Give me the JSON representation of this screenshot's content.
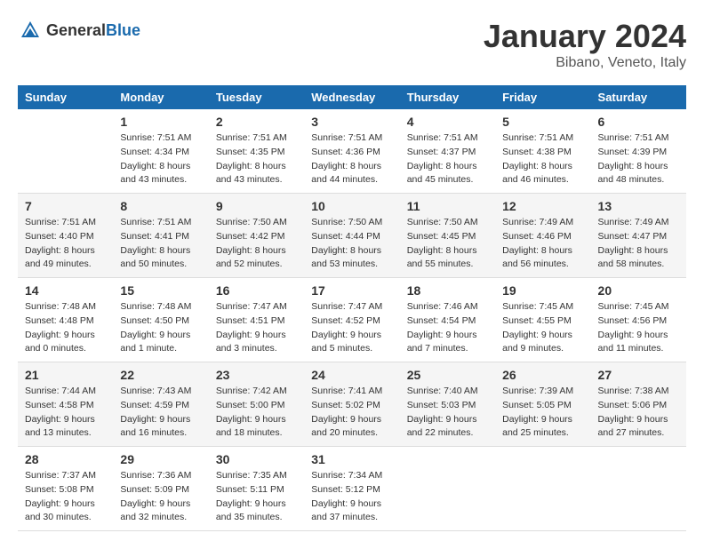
{
  "header": {
    "logo_general": "General",
    "logo_blue": "Blue",
    "title": "January 2024",
    "location": "Bibano, Veneto, Italy"
  },
  "days_of_week": [
    "Sunday",
    "Monday",
    "Tuesday",
    "Wednesday",
    "Thursday",
    "Friday",
    "Saturday"
  ],
  "weeks": [
    [
      {
        "day": "",
        "info": ""
      },
      {
        "day": "1",
        "info": "Sunrise: 7:51 AM\nSunset: 4:34 PM\nDaylight: 8 hours\nand 43 minutes."
      },
      {
        "day": "2",
        "info": "Sunrise: 7:51 AM\nSunset: 4:35 PM\nDaylight: 8 hours\nand 43 minutes."
      },
      {
        "day": "3",
        "info": "Sunrise: 7:51 AM\nSunset: 4:36 PM\nDaylight: 8 hours\nand 44 minutes."
      },
      {
        "day": "4",
        "info": "Sunrise: 7:51 AM\nSunset: 4:37 PM\nDaylight: 8 hours\nand 45 minutes."
      },
      {
        "day": "5",
        "info": "Sunrise: 7:51 AM\nSunset: 4:38 PM\nDaylight: 8 hours\nand 46 minutes."
      },
      {
        "day": "6",
        "info": "Sunrise: 7:51 AM\nSunset: 4:39 PM\nDaylight: 8 hours\nand 48 minutes."
      }
    ],
    [
      {
        "day": "7",
        "info": "Sunrise: 7:51 AM\nSunset: 4:40 PM\nDaylight: 8 hours\nand 49 minutes."
      },
      {
        "day": "8",
        "info": "Sunrise: 7:51 AM\nSunset: 4:41 PM\nDaylight: 8 hours\nand 50 minutes."
      },
      {
        "day": "9",
        "info": "Sunrise: 7:50 AM\nSunset: 4:42 PM\nDaylight: 8 hours\nand 52 minutes."
      },
      {
        "day": "10",
        "info": "Sunrise: 7:50 AM\nSunset: 4:44 PM\nDaylight: 8 hours\nand 53 minutes."
      },
      {
        "day": "11",
        "info": "Sunrise: 7:50 AM\nSunset: 4:45 PM\nDaylight: 8 hours\nand 55 minutes."
      },
      {
        "day": "12",
        "info": "Sunrise: 7:49 AM\nSunset: 4:46 PM\nDaylight: 8 hours\nand 56 minutes."
      },
      {
        "day": "13",
        "info": "Sunrise: 7:49 AM\nSunset: 4:47 PM\nDaylight: 8 hours\nand 58 minutes."
      }
    ],
    [
      {
        "day": "14",
        "info": "Sunrise: 7:48 AM\nSunset: 4:48 PM\nDaylight: 9 hours\nand 0 minutes."
      },
      {
        "day": "15",
        "info": "Sunrise: 7:48 AM\nSunset: 4:50 PM\nDaylight: 9 hours\nand 1 minute."
      },
      {
        "day": "16",
        "info": "Sunrise: 7:47 AM\nSunset: 4:51 PM\nDaylight: 9 hours\nand 3 minutes."
      },
      {
        "day": "17",
        "info": "Sunrise: 7:47 AM\nSunset: 4:52 PM\nDaylight: 9 hours\nand 5 minutes."
      },
      {
        "day": "18",
        "info": "Sunrise: 7:46 AM\nSunset: 4:54 PM\nDaylight: 9 hours\nand 7 minutes."
      },
      {
        "day": "19",
        "info": "Sunrise: 7:45 AM\nSunset: 4:55 PM\nDaylight: 9 hours\nand 9 minutes."
      },
      {
        "day": "20",
        "info": "Sunrise: 7:45 AM\nSunset: 4:56 PM\nDaylight: 9 hours\nand 11 minutes."
      }
    ],
    [
      {
        "day": "21",
        "info": "Sunrise: 7:44 AM\nSunset: 4:58 PM\nDaylight: 9 hours\nand 13 minutes."
      },
      {
        "day": "22",
        "info": "Sunrise: 7:43 AM\nSunset: 4:59 PM\nDaylight: 9 hours\nand 16 minutes."
      },
      {
        "day": "23",
        "info": "Sunrise: 7:42 AM\nSunset: 5:00 PM\nDaylight: 9 hours\nand 18 minutes."
      },
      {
        "day": "24",
        "info": "Sunrise: 7:41 AM\nSunset: 5:02 PM\nDaylight: 9 hours\nand 20 minutes."
      },
      {
        "day": "25",
        "info": "Sunrise: 7:40 AM\nSunset: 5:03 PM\nDaylight: 9 hours\nand 22 minutes."
      },
      {
        "day": "26",
        "info": "Sunrise: 7:39 AM\nSunset: 5:05 PM\nDaylight: 9 hours\nand 25 minutes."
      },
      {
        "day": "27",
        "info": "Sunrise: 7:38 AM\nSunset: 5:06 PM\nDaylight: 9 hours\nand 27 minutes."
      }
    ],
    [
      {
        "day": "28",
        "info": "Sunrise: 7:37 AM\nSunset: 5:08 PM\nDaylight: 9 hours\nand 30 minutes."
      },
      {
        "day": "29",
        "info": "Sunrise: 7:36 AM\nSunset: 5:09 PM\nDaylight: 9 hours\nand 32 minutes."
      },
      {
        "day": "30",
        "info": "Sunrise: 7:35 AM\nSunset: 5:11 PM\nDaylight: 9 hours\nand 35 minutes."
      },
      {
        "day": "31",
        "info": "Sunrise: 7:34 AM\nSunset: 5:12 PM\nDaylight: 9 hours\nand 37 minutes."
      },
      {
        "day": "",
        "info": ""
      },
      {
        "day": "",
        "info": ""
      },
      {
        "day": "",
        "info": ""
      }
    ]
  ]
}
